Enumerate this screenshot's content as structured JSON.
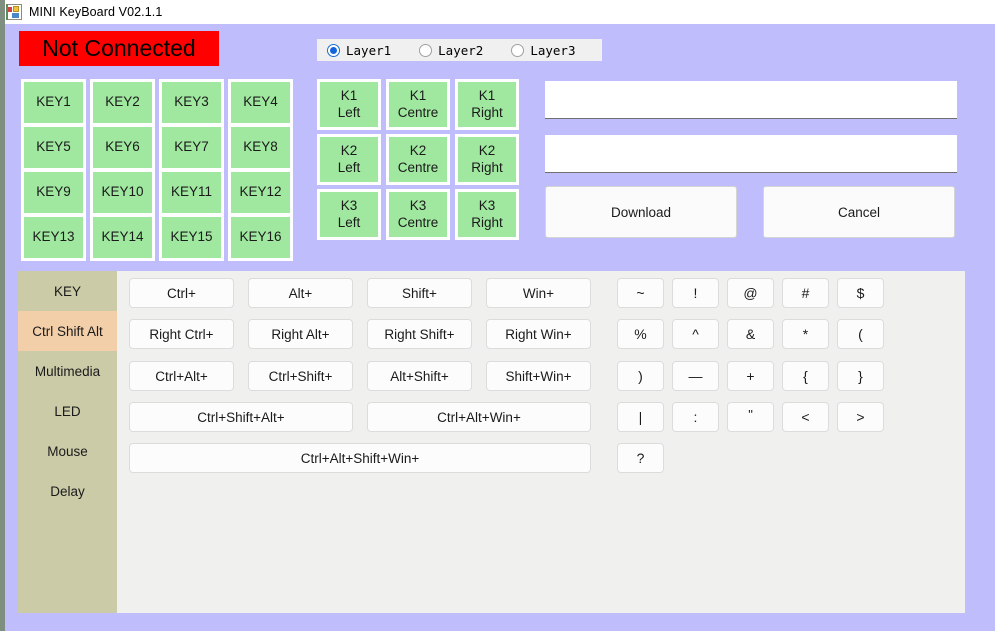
{
  "window": {
    "title": "MINI KeyBoard V02.1.1",
    "icon": "app-window-icon"
  },
  "status": {
    "label": "Not Connected",
    "bg_color": "#ff0000",
    "text_color": "#000000"
  },
  "layers": {
    "selected": "Layer1",
    "options": [
      {
        "label": "Layer1",
        "selected": true
      },
      {
        "label": "Layer2",
        "selected": false
      },
      {
        "label": "Layer3",
        "selected": false
      }
    ]
  },
  "keys": {
    "color": "#a0e8a0",
    "items": [
      {
        "label": "KEY1"
      },
      {
        "label": "KEY2"
      },
      {
        "label": "KEY3"
      },
      {
        "label": "KEY4"
      },
      {
        "label": "KEY5"
      },
      {
        "label": "KEY6"
      },
      {
        "label": "KEY7"
      },
      {
        "label": "KEY8"
      },
      {
        "label": "KEY9"
      },
      {
        "label": "KEY10"
      },
      {
        "label": "KEY11"
      },
      {
        "label": "KEY12"
      },
      {
        "label": "KEY13"
      },
      {
        "label": "KEY14"
      },
      {
        "label": "KEY15"
      },
      {
        "label": "KEY16"
      }
    ]
  },
  "knobs": {
    "items": [
      {
        "line1": "K1",
        "line2": "Left"
      },
      {
        "line1": "K1",
        "line2": "Centre"
      },
      {
        "line1": "K1",
        "line2": "Right"
      },
      {
        "line1": "K2",
        "line2": "Left"
      },
      {
        "line1": "K2",
        "line2": "Centre"
      },
      {
        "line1": "K2",
        "line2": "Right"
      },
      {
        "line1": "K3",
        "line2": "Left"
      },
      {
        "line1": "K3",
        "line2": "Centre"
      },
      {
        "line1": "K3",
        "line2": "Right"
      }
    ]
  },
  "fields": {
    "field1": {
      "value": "",
      "placeholder": ""
    },
    "field2": {
      "value": "",
      "placeholder": ""
    }
  },
  "actions": {
    "download_label": "Download",
    "cancel_label": "Cancel"
  },
  "sidebar": {
    "active": "Ctrl Shift Alt",
    "items": [
      {
        "label": "KEY",
        "active": false
      },
      {
        "label": "Ctrl Shift Alt",
        "active": true
      },
      {
        "label": "Multimedia",
        "active": false
      },
      {
        "label": "LED",
        "active": false
      },
      {
        "label": "Mouse",
        "active": false
      },
      {
        "label": "Delay",
        "active": false
      }
    ]
  },
  "modifiers": {
    "row1": [
      {
        "label": "Ctrl+"
      },
      {
        "label": "Alt+"
      },
      {
        "label": "Shift+"
      },
      {
        "label": "Win+"
      }
    ],
    "row2": [
      {
        "label": "Right  Ctrl+"
      },
      {
        "label": "Right Alt+"
      },
      {
        "label": "Right Shift+"
      },
      {
        "label": "Right Win+"
      }
    ],
    "row3": [
      {
        "label": "Ctrl+Alt+"
      },
      {
        "label": "Ctrl+Shift+"
      },
      {
        "label": "Alt+Shift+"
      },
      {
        "label": "Shift+Win+"
      }
    ],
    "row4": [
      {
        "label": "Ctrl+Shift+Alt+"
      },
      {
        "label": "Ctrl+Alt+Win+"
      }
    ],
    "row5": [
      {
        "label": "Ctrl+Alt+Shift+Win+"
      }
    ]
  },
  "symbols": {
    "row1": [
      {
        "label": "~"
      },
      {
        "label": "!"
      },
      {
        "label": "@"
      },
      {
        "label": "#"
      },
      {
        "label": "$"
      }
    ],
    "row2": [
      {
        "label": "%"
      },
      {
        "label": "^"
      },
      {
        "label": "&"
      },
      {
        "label": "*"
      },
      {
        "label": "("
      }
    ],
    "row3": [
      {
        "label": ")"
      },
      {
        "label": "—"
      },
      {
        "label": "+"
      },
      {
        "label": "{"
      },
      {
        "label": "}"
      }
    ],
    "row4": [
      {
        "label": "|"
      },
      {
        "label": ":"
      },
      {
        "label": "\""
      },
      {
        "label": "<"
      },
      {
        "label": ">"
      }
    ],
    "row5": [
      {
        "label": "?"
      }
    ]
  },
  "theme": {
    "form_bg": "#bfbdfb",
    "panel_bg": "#f0f0ee",
    "sidebar_bg": "#cbcba8",
    "sidebar_active_bg": "#f2cfa8",
    "key_green": "#a0e8a0",
    "accent_blue": "#1565d8"
  }
}
